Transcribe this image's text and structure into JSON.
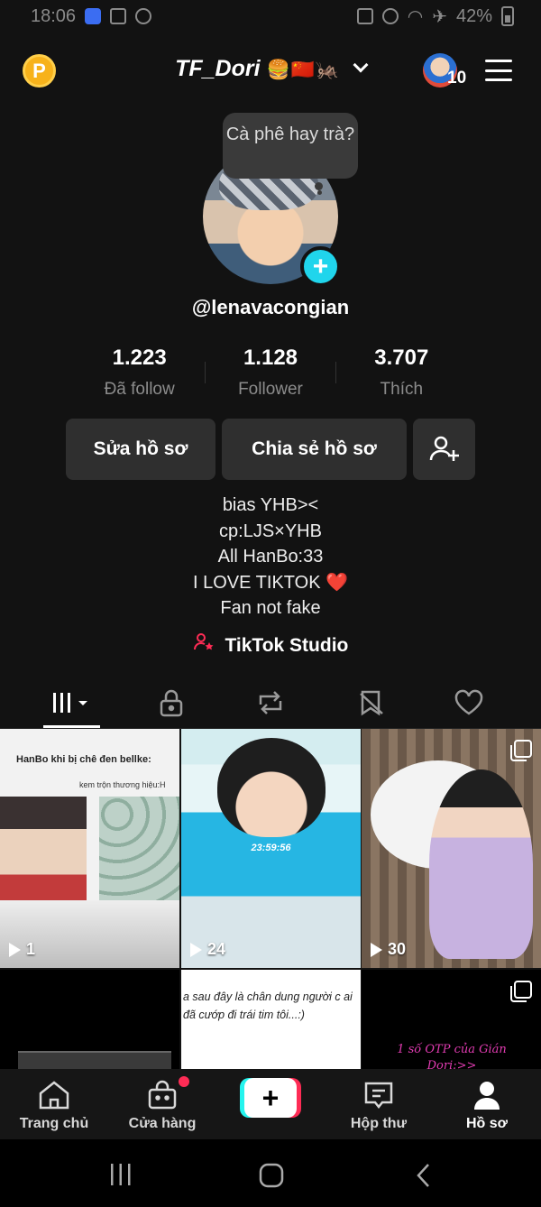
{
  "status_bar": {
    "time": "18:06",
    "battery": "42%"
  },
  "header": {
    "username": "TF_Dori",
    "username_emoji": "🍔🇨🇳🦗",
    "avatar_count": "10",
    "coin_letter": "P"
  },
  "profile": {
    "bubble_text": "Cà phê hay trà?",
    "handle": "@lenavacongian",
    "stats": [
      {
        "value": "1.223",
        "label": "Đã follow"
      },
      {
        "value": "1.128",
        "label": "Follower"
      },
      {
        "value": "3.707",
        "label": "Thích"
      }
    ],
    "buttons": {
      "edit": "Sửa hồ sơ",
      "share": "Chia sẻ hồ sơ"
    },
    "bio": [
      "bias YHB><",
      "cp:LJS×YHB",
      "All HanBo:33",
      "I LOVE TIKTOK ❤️",
      "Fan not fake"
    ],
    "studio_label": "TikTok Studio"
  },
  "videos": [
    {
      "count": "1",
      "title": "HanBo khi bị chê đen bellke:",
      "subtitle": "kem trộn thương hiệu:H"
    },
    {
      "count": "24",
      "timestamp": "23:59:56"
    },
    {
      "count": "30"
    },
    {
      "count": ""
    },
    {
      "text": "a sau đây là chân dung người c ai đã cướp đi trái tim tôi...:)"
    },
    {
      "text": "1 số OTP của Gián Dori:>>"
    }
  ],
  "bottom_nav": [
    {
      "label": "Trang chủ",
      "icon": "home-icon"
    },
    {
      "label": "Cửa hàng",
      "icon": "shop-icon"
    },
    {
      "label": "+",
      "icon": "create-icon"
    },
    {
      "label": "Hộp thư",
      "icon": "inbox-icon"
    },
    {
      "label": "Hồ sơ",
      "icon": "profile-icon"
    }
  ],
  "colors": {
    "accent_cyan": "#20d5ec",
    "accent_red": "#fe2c55",
    "coin": "#f7b21b",
    "background": "#121212"
  }
}
